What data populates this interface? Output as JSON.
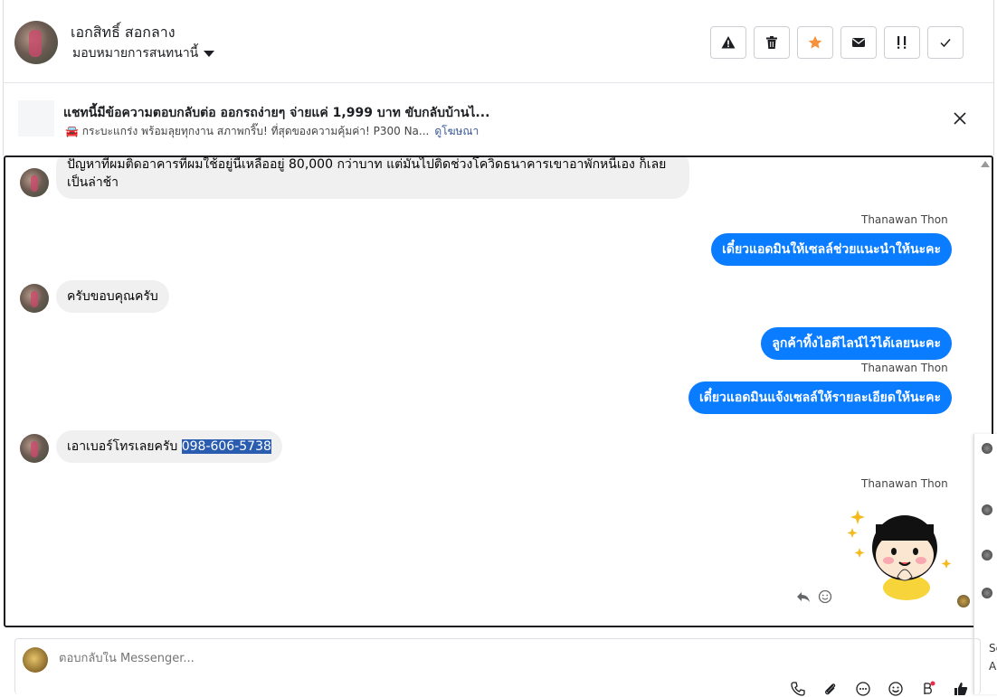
{
  "header": {
    "contact_name": "เอกสิทธิ์ สอกลาง",
    "assign_label": "มอบหมายการสนทนานี้",
    "actions": [
      {
        "icon": "warning-icon",
        "label": "Spam"
      },
      {
        "icon": "trash-icon",
        "label": "Delete"
      },
      {
        "icon": "star-icon",
        "label": "Star"
      },
      {
        "icon": "envelope-icon",
        "label": "Mark unread"
      },
      {
        "icon": "follow-up-icon",
        "label": "Follow up"
      },
      {
        "icon": "check-icon",
        "label": "Done"
      }
    ],
    "star_color": "#f7923b"
  },
  "ad": {
    "title": "แชทนี้มีข้อความตอบกลับต่อ ออกรถง่ายๆ จ่ายแค่ 1,999 บาท ขับกลับบ้านไ...",
    "subtitle": "🚘 กระบะแกร่ง พร้อมลุยทุกงาน สภาพกริ๊บ! ที่สุดของความคุ้มค่า! P300 Na...",
    "link": "ดูโฆษณา"
  },
  "messages": [
    {
      "dir": "in",
      "text": "ปัญหาที่ผมติดอาคารที่ผมใช้อยู่นี้เหลืออยู่ 80,000 กว่าบาท แต่มันไปติดช่วงโควิดธนาคารเขาอาพักหนี้เอง ก็เลยเป็นล่าช้า"
    },
    {
      "dir": "out",
      "sender": "Thanawan Thon",
      "text": "เดี๋ยวแอดมินให้เซลล์ช่วยแนะนำให้นะคะ"
    },
    {
      "dir": "in",
      "text": "ครับขอบคุณครับ"
    },
    {
      "dir": "out",
      "text": "ลูกค้าทิ้งไอดีไลน์ไว้ได้เลยนะคะ"
    },
    {
      "dir": "out",
      "sender": "Thanawan Thon",
      "text": "เดี๋ยวแอดมินแจ้งเซลล์ให้รายละเอียดให้นะคะ"
    },
    {
      "dir": "in",
      "text_prefix": "เอาเบอร์โทรเลยครับ ",
      "text_highlight": "098-606-5738"
    },
    {
      "dir": "out",
      "sender": "Thanawan Thon",
      "sticker": "girl-praying-sticker"
    }
  ],
  "side_panel": {
    "text1": "Sc",
    "text2": "A"
  },
  "composer": {
    "placeholder": "ตอบกลับใน Messenger..."
  },
  "colors": {
    "outgoing_bubble": "#0a7cff",
    "incoming_bubble": "#f0f0f0",
    "selection": "#2a5db0"
  }
}
